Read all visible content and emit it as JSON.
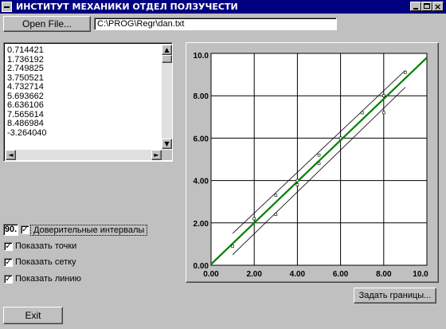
{
  "window": {
    "title": "ИНСТИТУТ МЕХАНИКИ ОТДЕЛ ПОЛЗУЧЕСТИ"
  },
  "toolbar": {
    "open_label": "Open File...",
    "path_value": "C:\\PROG\\Regr\\dan.txt"
  },
  "values_list": [
    "0.714421",
    "1.736192",
    "2.749825",
    "3.750521",
    "4.732714",
    "5.693662",
    "6.636106",
    "7.565614",
    "8.486984",
    "-3.264040"
  ],
  "options": {
    "confidence_value": "90.",
    "confidence_label": "Доверительные интервалы",
    "show_points": "Показать точки",
    "show_grid": "Показать сетку",
    "show_line": "Показать линию"
  },
  "buttons": {
    "bounds_label": "Задать границы...",
    "exit_label": "Exit"
  },
  "colors": {
    "fit_line": "#008000",
    "titlebar": "#000080"
  },
  "chart_data": {
    "type": "scatter",
    "xlim": [
      0,
      10
    ],
    "ylim": [
      0,
      10
    ],
    "grid": true,
    "xticks": [
      "0.00",
      "2.00",
      "4.00",
      "6.00",
      "8.00",
      "10.0"
    ],
    "yticks": [
      "0.00",
      "2.00",
      "4.00",
      "6.00",
      "8.00",
      "10.0"
    ],
    "points": [
      {
        "x": 1.0,
        "y": 0.9
      },
      {
        "x": 2.0,
        "y": 2.2
      },
      {
        "x": 3.0,
        "y": 2.4
      },
      {
        "x": 3.0,
        "y": 3.3
      },
      {
        "x": 4.0,
        "y": 3.8
      },
      {
        "x": 4.0,
        "y": 4.0
      },
      {
        "x": 5.0,
        "y": 4.8
      },
      {
        "x": 5.0,
        "y": 5.2
      },
      {
        "x": 6.0,
        "y": 6.0
      },
      {
        "x": 7.0,
        "y": 7.2
      },
      {
        "x": 8.0,
        "y": 7.2
      },
      {
        "x": 8.0,
        "y": 8.0
      },
      {
        "x": 9.0,
        "y": 9.1
      }
    ],
    "fit_line": [
      [
        0,
        0.05
      ],
      [
        10,
        9.8
      ]
    ],
    "upper_band": [
      [
        1,
        1.5
      ],
      [
        9,
        9.2
      ]
    ],
    "lower_band": [
      [
        1,
        0.5
      ],
      [
        9,
        8.4
      ]
    ]
  }
}
